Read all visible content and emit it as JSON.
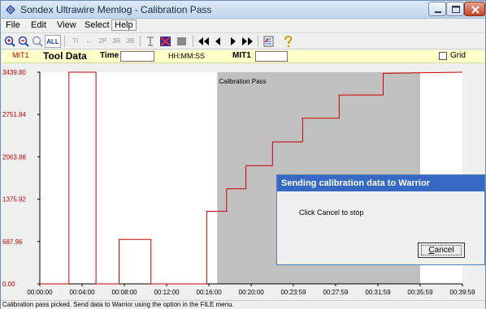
{
  "window": {
    "title": "Sondex Ultrawire Memlog - Calibration Pass"
  },
  "menu": {
    "items": [
      "File",
      "Edit",
      "View",
      "Select",
      "Help"
    ]
  },
  "toolbar": {
    "buttons": [
      {
        "name": "zoom-in-icon"
      },
      {
        "name": "zoom-out-icon"
      },
      {
        "name": "zoom-prev-icon"
      },
      {
        "name": "zoom-all-button",
        "label": "ALL"
      },
      {
        "name": "ti-button",
        "label": "TI"
      },
      {
        "name": "pan-button",
        "label": "↔"
      },
      {
        "name": "2p-button",
        "label": "2P"
      },
      {
        "name": "3r-button",
        "label": "3R"
      },
      {
        "name": "3b-button",
        "label": "3B"
      },
      {
        "name": "calibrate-icon"
      },
      {
        "name": "cancel-cal-icon"
      },
      {
        "name": "stop-icon"
      },
      {
        "name": "first-icon"
      },
      {
        "name": "prev-icon"
      },
      {
        "name": "next-icon"
      },
      {
        "name": "last-icon"
      },
      {
        "name": "data-icon"
      },
      {
        "name": "help-icon"
      }
    ]
  },
  "databar": {
    "channel": "MIT1",
    "tool_data_label": "Tool Data",
    "time_label": "Time",
    "time_value": "",
    "time_format": "HH:MM:SS",
    "mit_label": "MIT1",
    "mit_value": "",
    "grid_label": "Grid",
    "grid_checked": false
  },
  "chart_data": {
    "type": "line",
    "series": [
      {
        "name": "MIT1",
        "color": "#cc0000",
        "points": [
          [
            "00:00:00",
            0.0
          ],
          [
            "00:02:45",
            0.0
          ],
          [
            "00:02:45",
            3439.8
          ],
          [
            "00:05:19",
            3439.8
          ],
          [
            "00:05:19",
            0.0
          ],
          [
            "00:07:30",
            0.0
          ],
          [
            "00:07:30",
            721.0
          ],
          [
            "00:10:31",
            721.0
          ],
          [
            "00:10:31",
            0.0
          ],
          [
            "00:15:47",
            0.0
          ],
          [
            "00:15:47",
            1179.0
          ],
          [
            "00:17:40",
            1179.0
          ],
          [
            "00:17:40",
            1546.0
          ],
          [
            "00:19:30",
            1546.0
          ],
          [
            "00:19:30",
            1922.0
          ],
          [
            "00:22:01",
            1922.0
          ],
          [
            "00:22:01",
            2307.0
          ],
          [
            "00:24:52",
            2307.0
          ],
          [
            "00:24:52",
            2692.0
          ],
          [
            "00:28:19",
            2692.0
          ],
          [
            "00:28:19",
            3069.0
          ],
          [
            "00:32:29",
            3069.0
          ],
          [
            "00:32:29",
            3421.0
          ],
          [
            "00:39:59",
            3439.8
          ]
        ]
      }
    ],
    "y_ticks": [
      "0.00",
      "687.96",
      "1375.92",
      "2063.88",
      "2751.84",
      "3439.80"
    ],
    "x_ticks": [
      "00:00:00",
      "00:04:00",
      "00:08:00",
      "00:12:00",
      "00:16:00",
      "00:20:00",
      "00:23:59",
      "00:27:59",
      "00:31:59",
      "00:35:59",
      "00:39:59"
    ],
    "ylim": [
      0.0,
      3439.8
    ],
    "xlim": [
      "00:00:00",
      "00:39:59"
    ],
    "grid": false,
    "highlight": {
      "label": "Calibration Pass",
      "start": "00:16:47",
      "end": "00:35:59",
      "color": "#c0c0c0"
    }
  },
  "status": {
    "text": "Calibration pass picked. Send data to Warrior using the option in the FILE menu."
  },
  "dialog": {
    "title": "Sending calibration data to Warrior",
    "message": "Click Cancel to stop",
    "cancel_label": "Cancel"
  }
}
